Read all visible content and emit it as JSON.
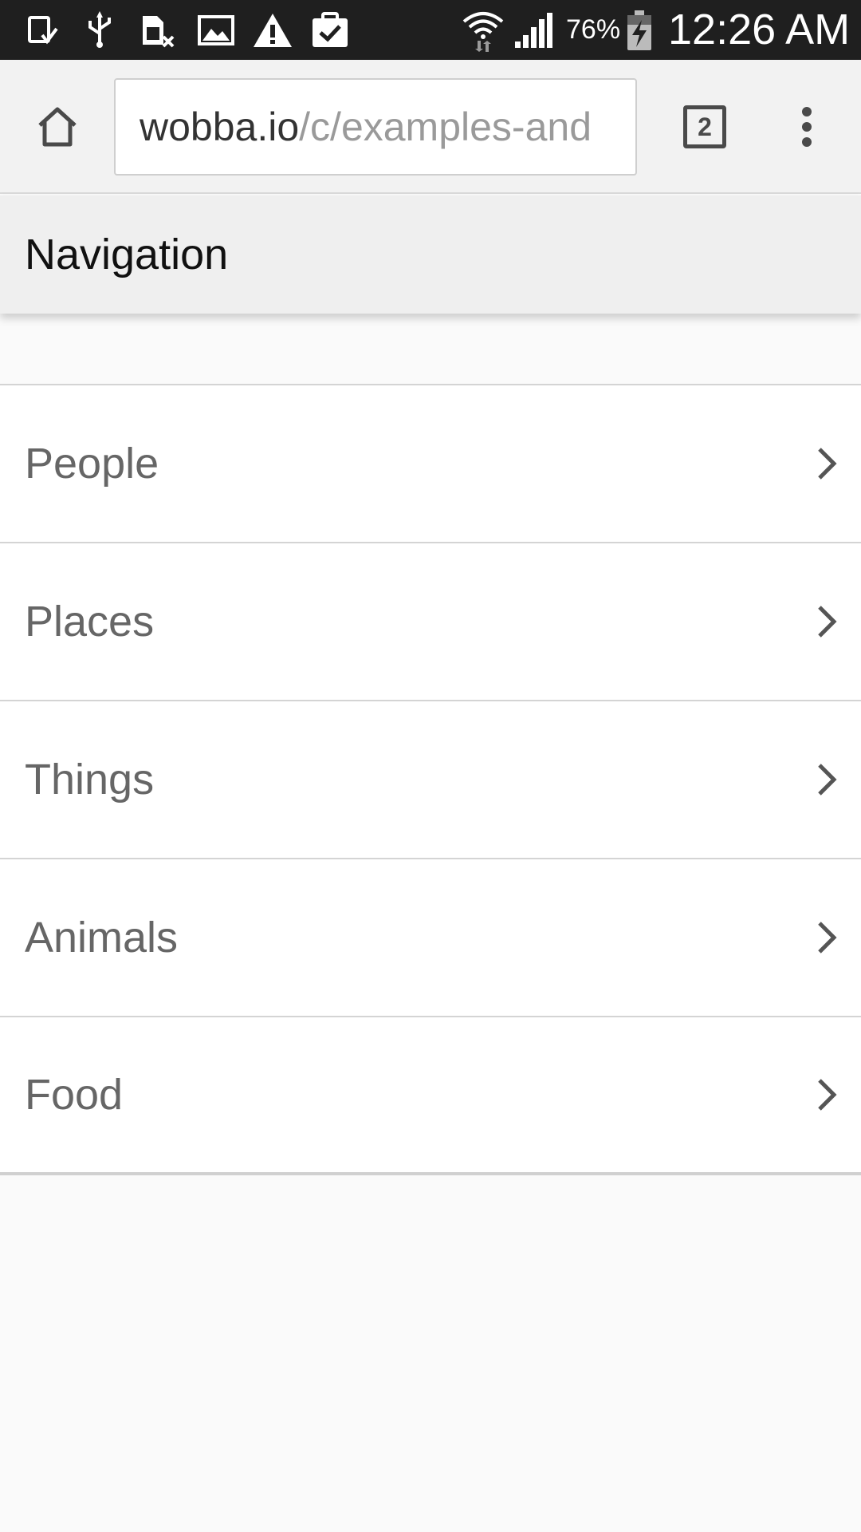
{
  "status_bar": {
    "battery_percent": "76%",
    "time": "12:26 AM",
    "notification_icons": [
      "download-complete-icon",
      "usb-icon",
      "sim-error-icon",
      "image-icon",
      "warning-icon",
      "clipboard-check-icon"
    ],
    "system_icons": [
      "wifi-icon",
      "signal-icon",
      "battery-charging-icon"
    ]
  },
  "browser": {
    "url_host": "wobba.io",
    "url_path": "/c/examples-and",
    "tab_count": "2"
  },
  "page": {
    "title": "Navigation"
  },
  "nav": {
    "items": [
      {
        "label": "People"
      },
      {
        "label": "Places"
      },
      {
        "label": "Things"
      },
      {
        "label": "Animals"
      },
      {
        "label": "Food"
      }
    ]
  }
}
